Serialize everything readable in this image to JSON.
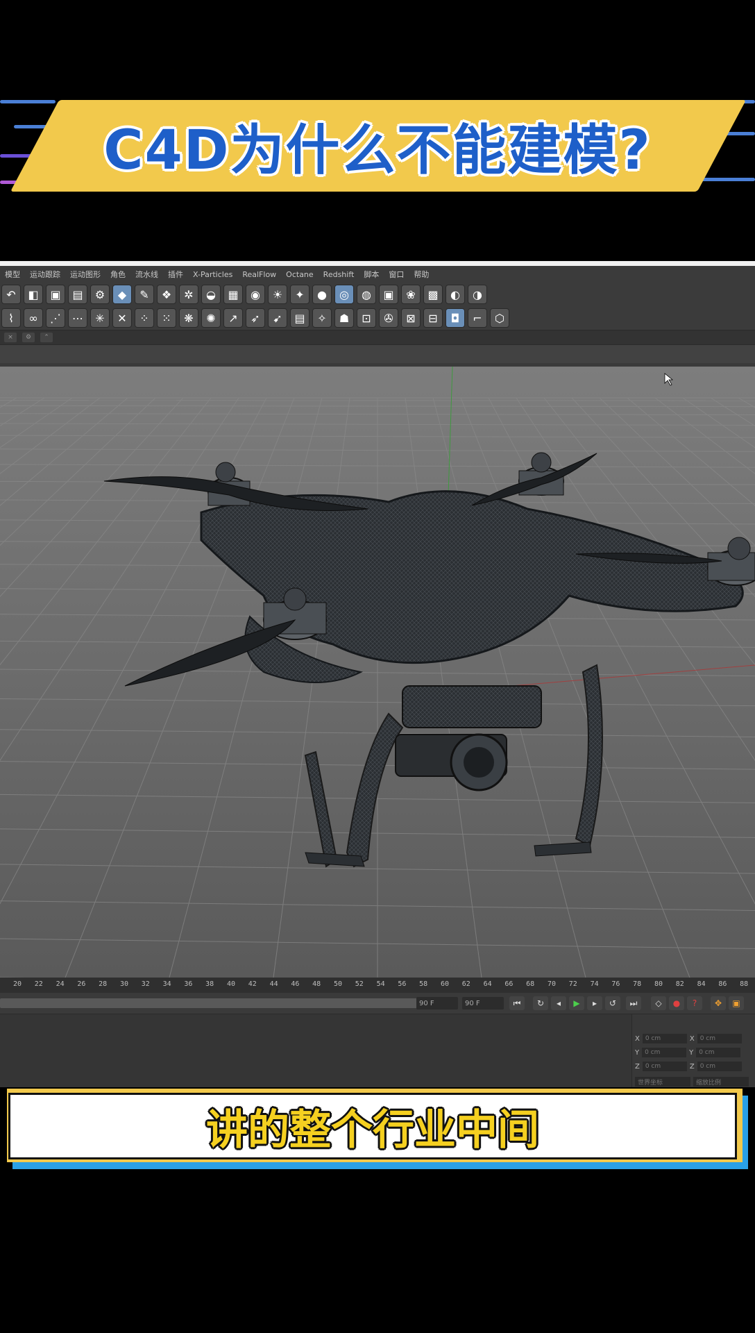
{
  "banner": {
    "title": "C4D为什么不能建模?"
  },
  "menu": [
    "模型",
    "运动跟踪",
    "运动图形",
    "角色",
    "流水线",
    "插件",
    "X-Particles",
    "RealFlow",
    "Octane",
    "Redshift",
    "脚本",
    "窗口",
    "帮助"
  ],
  "timeline": {
    "ticks": [
      "20",
      "22",
      "24",
      "26",
      "28",
      "30",
      "32",
      "34",
      "36",
      "38",
      "40",
      "42",
      "44",
      "46",
      "48",
      "50",
      "52",
      "54",
      "56",
      "58",
      "60",
      "62",
      "64",
      "66",
      "68",
      "70",
      "72",
      "74",
      "76",
      "78",
      "80",
      "82",
      "84",
      "86",
      "88"
    ],
    "end_frame_a": "90 F",
    "end_frame_b": "90 F"
  },
  "attributes": {
    "rows": [
      {
        "axis": "X",
        "value": "0 cm",
        "axis2": "X",
        "value2": "0 cm"
      },
      {
        "axis": "Y",
        "value": "0 cm",
        "axis2": "Y",
        "value2": "0 cm"
      },
      {
        "axis": "Z",
        "value": "0 cm",
        "axis2": "Z",
        "value2": "0 cm"
      }
    ],
    "coord_mode": "世界坐标",
    "scale_mode": "缩放比例"
  },
  "subtitle": "讲的整个行业中间",
  "colors": {
    "banner_bg": "#f2c94c",
    "banner_text": "#1e5fc9",
    "subtitle_text": "#f5d020",
    "subtitle_shadow": "#2aa0e6"
  }
}
